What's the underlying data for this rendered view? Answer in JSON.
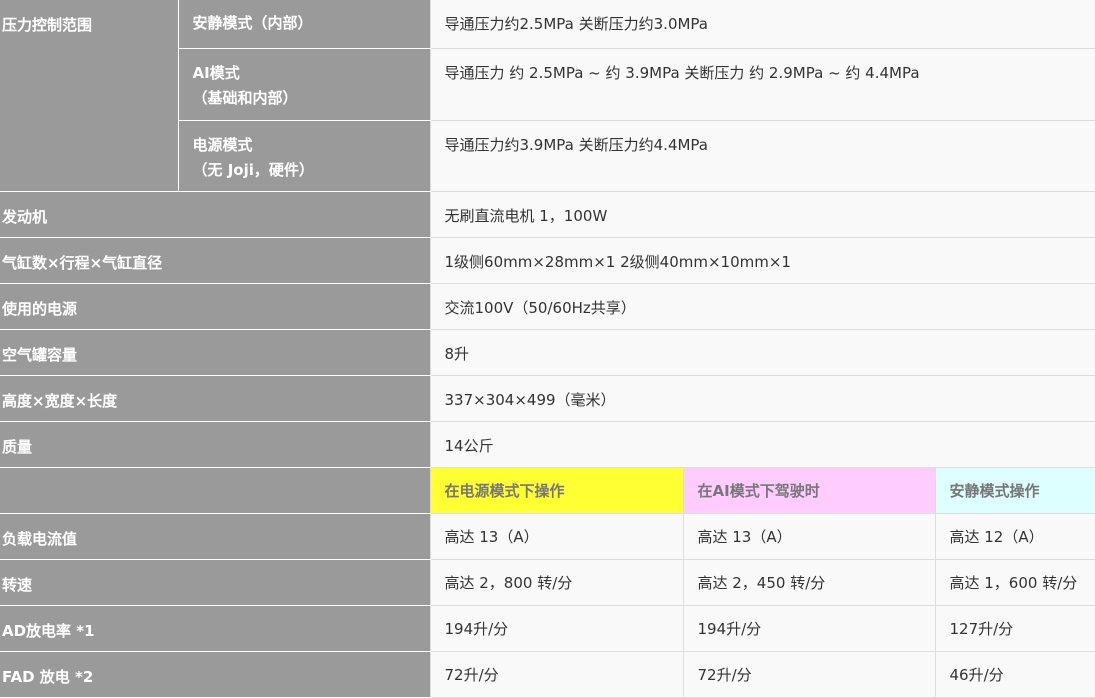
{
  "pressure": {
    "label": "压力控制范围",
    "quiet": {
      "name": "安静模式（内部）",
      "value": "导通压力约2.5MPa 关断压力约3.0MPa"
    },
    "ai": {
      "name_line1": "AI模式",
      "name_line2": "（基础和内部）",
      "value": "导通压力 约 2.5MPa ~ 约 3.9MPa 关断压力 约 2.9MPa ~ 约 4.4MPa"
    },
    "power": {
      "name_line1": "电源模式",
      "name_line2": "（无 Joji，硬件）",
      "value": "导通压力约3.9MPa 关断压力约4.4MPa"
    }
  },
  "specs": [
    {
      "label": "发动机",
      "value": "无刷直流电机 1，100W"
    },
    {
      "label": "气缸数×行程×气缸直径",
      "value": "1级侧60mm×28mm×1 2级侧40mm×10mm×1"
    },
    {
      "label": "使用的电源",
      "value": "交流100V（50/60Hz共享）"
    },
    {
      "label": "空气罐容量",
      "value": "8升"
    },
    {
      "label": "高度×宽度×长度",
      "value": "337×304×499（毫米）"
    },
    {
      "label": "质量",
      "value": "14公斤"
    }
  ],
  "modes": {
    "header_label": "",
    "power": "在电源模式下操作",
    "ai": "在AI模式下驾驶时",
    "quiet": "安静模式操作"
  },
  "mode_rows": [
    {
      "label": "负载电流值",
      "power": "高达 13（A）",
      "ai": "高达 13（A）",
      "quiet": "高达 12（A）"
    },
    {
      "label": "转速",
      "power": "高达 2，800 转/分",
      "ai": "高达 2，450 转/分",
      "quiet": "高达 1，600 转/分"
    },
    {
      "label": "AD放电率 *1",
      "power": "194升/分",
      "ai": "194升/分",
      "quiet": "127升/分"
    },
    {
      "label": "FAD 放电 *2",
      "power": "72升/分",
      "ai": "72升/分",
      "quiet": "46升/分"
    }
  ],
  "colors": {
    "label_bg": "#9a9a9a",
    "value_bg": "#f9f9f9",
    "power_hdr": "#ffff33",
    "ai_hdr": "#ffccff",
    "quiet_hdr": "#ddffff"
  }
}
